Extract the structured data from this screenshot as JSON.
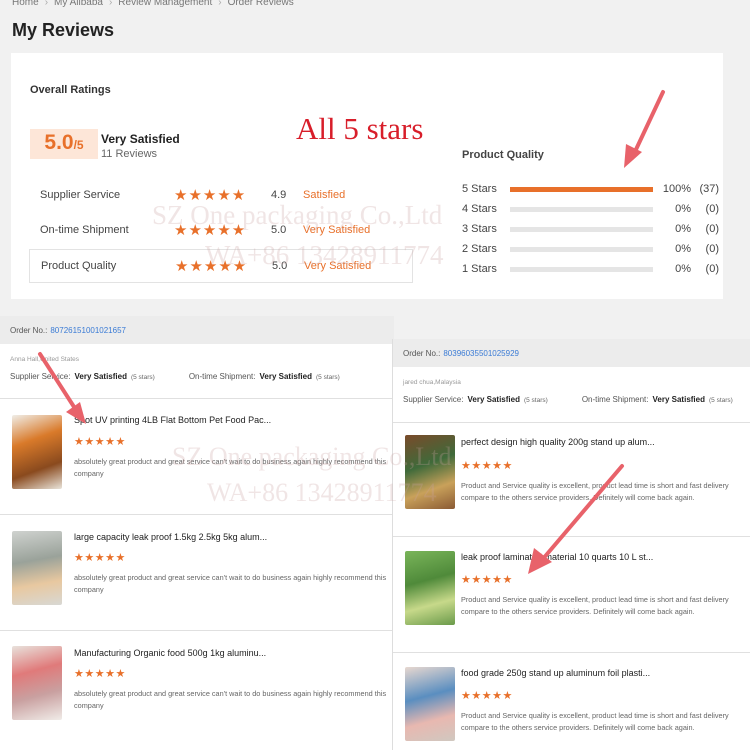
{
  "breadcrumb": [
    "Home",
    "My Alibaba",
    "Review Management",
    "Order Reviews"
  ],
  "page_title": "My Reviews",
  "overall": {
    "title": "Overall Ratings",
    "score": "5.0",
    "score_suffix": "/5",
    "label": "Very Satisfied",
    "count": "11 Reviews"
  },
  "categories": [
    {
      "name": "Supplier Service",
      "stars": "★★★★★",
      "score": "4.9",
      "label": "Satisfied"
    },
    {
      "name": "On-time Shipment",
      "stars": "★★★★★",
      "score": "5.0",
      "label": "Very Satisfied"
    },
    {
      "name": "Product Quality",
      "stars": "★★★★★",
      "score": "5.0",
      "label": "Very Satisfied"
    }
  ],
  "annotation": "All 5 stars",
  "product_quality": {
    "title": "Product Quality",
    "rows": [
      {
        "label": "5 Stars",
        "fraction": 1.0,
        "pct": "100%",
        "count": "(37)"
      },
      {
        "label": "4 Stars",
        "fraction": 0,
        "pct": "0%",
        "count": "(0)"
      },
      {
        "label": "3 Stars",
        "fraction": 0,
        "pct": "0%",
        "count": "(0)"
      },
      {
        "label": "2 Stars",
        "fraction": 0,
        "pct": "0%",
        "count": "(0)"
      },
      {
        "label": "1 Stars",
        "fraction": 0,
        "pct": "0%",
        "count": "(0)"
      }
    ]
  },
  "watermark": {
    "line1": "SZ One packaging Co.,Ltd",
    "line2": "WA+86 13428911774"
  },
  "left_order": {
    "order_label": "Order No.:",
    "order_no": "80726151001021657",
    "buyer": "Anna Hall,United States",
    "supplier_label": "Supplier Service:",
    "supplier_value": "Very Satisfied",
    "supplier_stars": "(5 stars)",
    "shipment_label": "On-time Shipment:",
    "shipment_value": "Very Satisfied",
    "shipment_stars": "(5 stars)",
    "reviews": [
      {
        "title": "Spot UV printing 4LB Flat Bottom Pet Food Pac...",
        "stars": "★★★★★",
        "text": "absolutely great product and great service can't wait to do business again highly recommend this company"
      },
      {
        "title": "large capacity leak proof 1.5kg 2.5kg 5kg alum...",
        "stars": "★★★★★",
        "text": "absolutely great product and great service can't wait to do business again highly recommend this company"
      },
      {
        "title": "Manufacturing Organic food 500g 1kg aluminu...",
        "stars": "★★★★★",
        "text": "absolutely great product and great service can't wait to do business again highly recommend this company"
      }
    ]
  },
  "right_order": {
    "order_label": "Order No.:",
    "order_no": "80396035501025929",
    "buyer": "jared chua,Malaysia",
    "supplier_label": "Supplier Service:",
    "supplier_value": "Very Satisfied",
    "supplier_stars": "(5 stars)",
    "shipment_label": "On-time Shipment:",
    "shipment_value": "Very Satisfied",
    "shipment_stars": "(5 stars)",
    "reviews": [
      {
        "title": "perfect design high quality 200g stand up alum...",
        "stars": "★★★★★",
        "text": "Product and Service quality is excellent, product lead time is short and fast delivery compare to the others service providers. Definitely will come back again."
      },
      {
        "title": "leak proof laminated material 10 quarts 10 L st...",
        "stars": "★★★★★",
        "text": "Product and Service quality is excellent, product lead time is short and fast delivery compare to the others service providers. Definitely will come back again."
      },
      {
        "title": "food grade 250g stand up aluminum foil plasti...",
        "stars": "★★★★★",
        "text": "Product and Service quality is excellent, product lead time is short and fast delivery compare to the others service providers. Definitely will come back again."
      }
    ]
  },
  "colors": {
    "accent": "#e8702a",
    "annotation": "#d81e2a",
    "arrow": "#e8626a",
    "link": "#3a7bd5"
  }
}
